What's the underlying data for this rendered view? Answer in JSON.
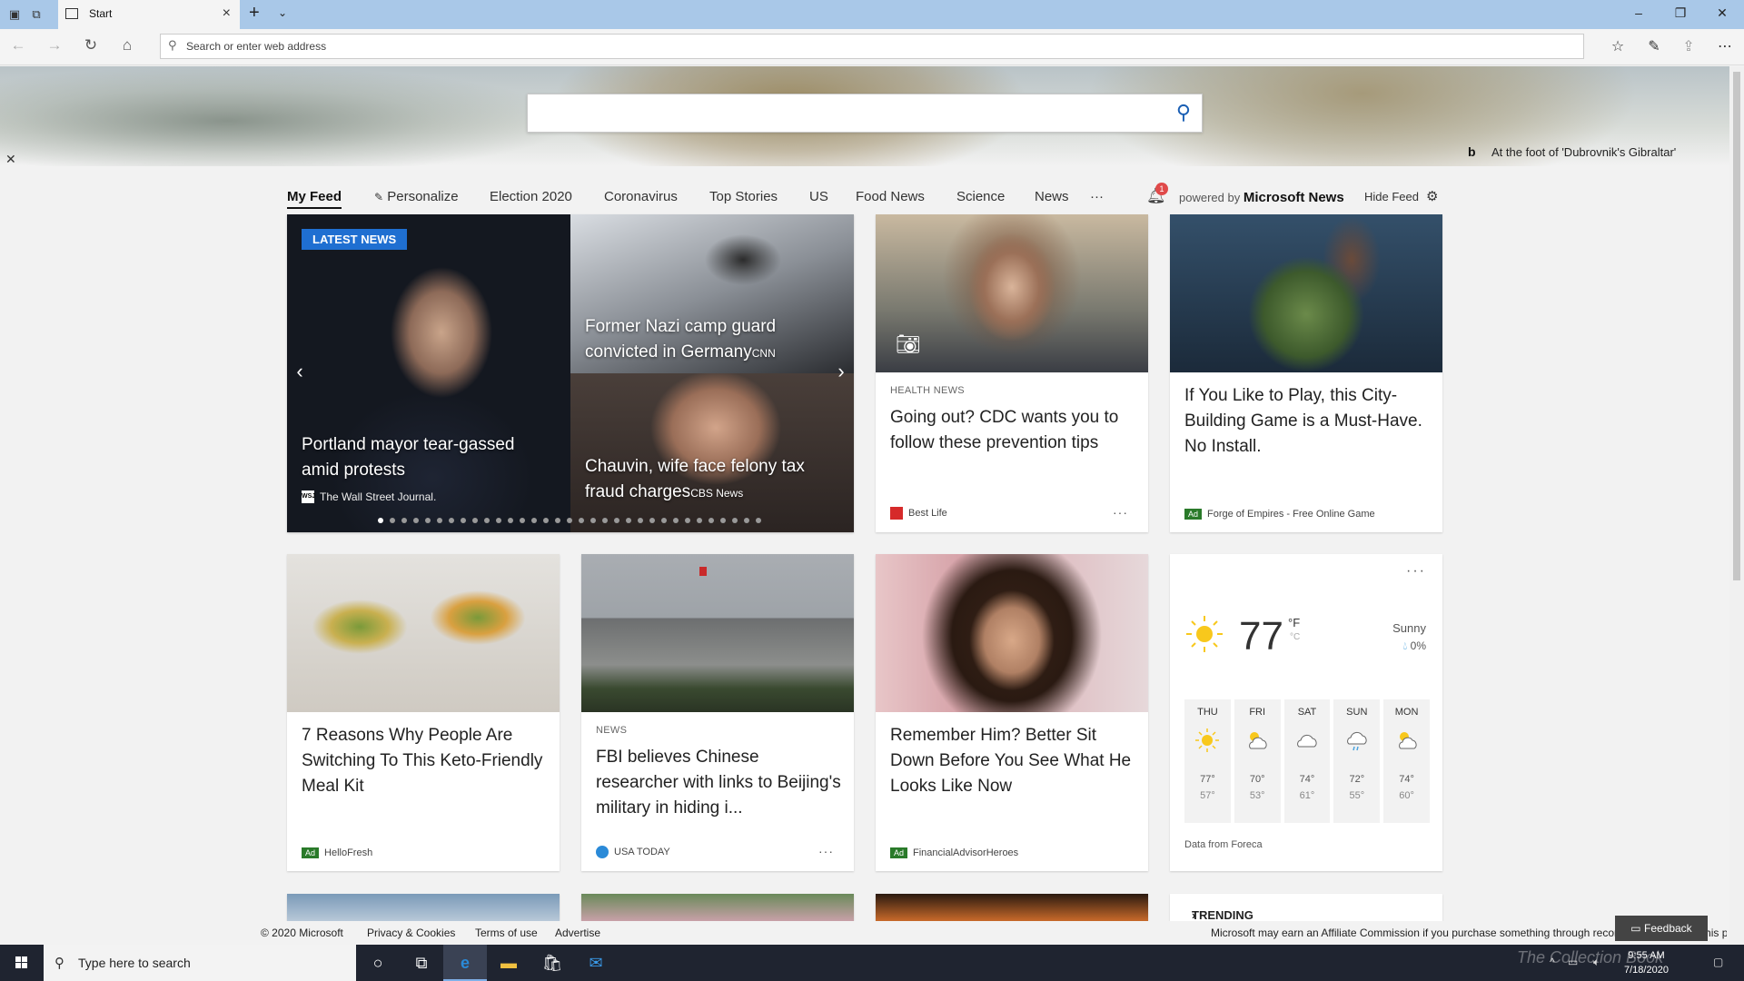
{
  "browser": {
    "tab_title": "Start",
    "address_placeholder": "Search or enter web address"
  },
  "hero": {
    "search_value": "",
    "caption": "At the foot of 'Dubrovnik's Gibraltar'",
    "bing_logo": "b"
  },
  "feednav": {
    "items": [
      "My Feed",
      "Personalize",
      "Election 2020",
      "Coronavirus",
      "Top Stories",
      "US",
      "Food News",
      "Science",
      "News",
      "···"
    ],
    "notification_count": "1",
    "powered_prefix": "powered by",
    "powered_brand": "Microsoft News",
    "hide_feed": "Hide Feed"
  },
  "carousel": {
    "badge": "LATEST NEWS",
    "main_title": "Portland mayor tear-gassed amid protests",
    "main_source": "The Wall Street Journal.",
    "main_logo": "WSJ",
    "top_title": "Former Nazi camp guard convicted in Germany",
    "top_source": "CNN",
    "bottom_title": "Chauvin, wife face felony tax fraud charges",
    "bottom_source": "CBS News",
    "dot_count": 33,
    "active_dot": 0
  },
  "cards": {
    "cdc": {
      "category": "HEALTH NEWS",
      "title": "Going out? CDC wants you to follow these prevention tips",
      "source": "Best Life",
      "more": "···"
    },
    "forge": {
      "title": "If You Like to Play, this City-Building Game is a Must-Have. No Install.",
      "ad": "Ad",
      "source": "Forge of Empires - Free Online Game"
    },
    "keto": {
      "title": "7 Reasons Why People Are Switching To This Keto-Friendly Meal Kit",
      "ad": "Ad",
      "source": "HelloFresh"
    },
    "fbi": {
      "category": "NEWS",
      "title": "FBI believes Chinese researcher with links to Beijing's military in hiding i...",
      "source": "USA TODAY",
      "more": "···"
    },
    "hurley": {
      "title": "Remember Him? Better Sit Down Before You See What He Looks Like Now",
      "ad": "Ad",
      "source": "FinancialAdvisorHeroes"
    }
  },
  "weather": {
    "more": "···",
    "temp": "77",
    "unit_f": "°F",
    "unit_c": "°C",
    "condition": "Sunny",
    "precip": "0%",
    "days": [
      {
        "day": "THU",
        "icon": "sun-icon",
        "hi": "77°",
        "lo": "57°"
      },
      {
        "day": "FRI",
        "icon": "partly-sunny-icon",
        "hi": "70°",
        "lo": "53°"
      },
      {
        "day": "SAT",
        "icon": "cloud-icon",
        "hi": "74°",
        "lo": "61°"
      },
      {
        "day": "SUN",
        "icon": "rain-cloud-icon",
        "hi": "72°",
        "lo": "55°"
      },
      {
        "day": "MON",
        "icon": "partly-sunny-icon",
        "hi": "74°",
        "lo": "60°"
      }
    ],
    "source": "Data from Foreca"
  },
  "trending": "TRENDING NOW",
  "footer": {
    "copyright": "© 2020 Microsoft",
    "privacy": "Privacy & Cookies",
    "terms": "Terms of use",
    "advertise": "Advertise",
    "affiliate": "Microsoft may earn an Affiliate Commission if you purchase something through recommended links in this page.",
    "feedback": "Feedback"
  },
  "taskbar": {
    "search_placeholder": "Type here to search",
    "time": "9:55 AM",
    "date": "7/18/2020",
    "watermark": "The Collection Book"
  },
  "colors": {
    "accent": "#1f6fd1",
    "ad_green": "#2a7a2a",
    "badge_red": "#e04a4a",
    "titlebar": "#a9c8e8",
    "taskbar": "#1f2430"
  }
}
